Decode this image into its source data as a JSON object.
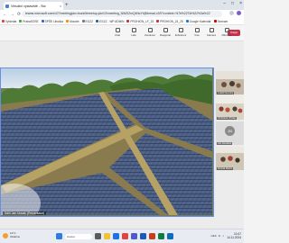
{
  "browser": {
    "tab_title": "Virtuální výstaviště - Sta",
    "tab_close": "×",
    "new_tab": "+",
    "window_controls": [
      "–",
      "□",
      "×"
    ],
    "url": "teams.microsoft.com/v2/?meetingjoin=true#/l/meetup-join/19:meeting_NWZiZmQ4NzYt@thread.v2/0?context=%7b%22Tid%22%3a%22",
    "nav": [
      "←",
      "→",
      "⟳"
    ],
    "bookmarks": [
      {
        "label": "Vyhledat",
        "color": "#d44"
      },
      {
        "label": "PrahaSOSE",
        "color": "#4a4"
      },
      {
        "label": "SPŠE Libuška",
        "color": "#36c"
      },
      {
        "label": "Moodle",
        "color": "#f80"
      },
      {
        "label": "EGZZ",
        "color": "#777"
      },
      {
        "label": "EGZZ - WP ADMIN",
        "color": "#26a"
      },
      {
        "label": "PROHION_LF_23",
        "color": "#c33"
      },
      {
        "label": "PROHION_24_25",
        "color": "#c33"
      },
      {
        "label": "Google Kalendář",
        "color": "#1a73e8"
      },
      {
        "label": "Seznam",
        "color": "#c00"
      }
    ]
  },
  "toolbar": {
    "buttons": [
      {
        "label": "Chat",
        "icon": "chat-icon"
      },
      {
        "label": "Lidé",
        "icon": "people-icon"
      },
      {
        "label": "Zvednout",
        "icon": "raise-hand-icon"
      },
      {
        "label": "Reagovat",
        "icon": "react-icon"
      },
      {
        "label": "Zobrazení",
        "icon": "view-icon"
      },
      {
        "label": "Více",
        "icon": "more-icon"
      },
      {
        "label": "Kamera",
        "icon": "camera-icon"
      },
      {
        "label": "Mikrofon",
        "icon": "mic-icon"
      },
      {
        "label": "Sdílet",
        "icon": "share-icon"
      }
    ],
    "leave_label": "Odejít"
  },
  "shared_screen": {
    "presenter_label": "Sdílí Jan Novák (Prezentace)"
  },
  "participants": [
    {
      "name": "Lukáš Novotný"
    },
    {
      "name": "VS Dobré (Třída)"
    },
    {
      "name": "Jan Nováček",
      "initials": "JN"
    },
    {
      "name": "Dvořák Martin"
    }
  ],
  "taskbar": {
    "weather_temp": "12°C",
    "weather_desc": "Oblačno",
    "search_placeholder": "Hledat",
    "time": "10:47",
    "date": "14.11.2024",
    "tray_lang": "CES"
  }
}
